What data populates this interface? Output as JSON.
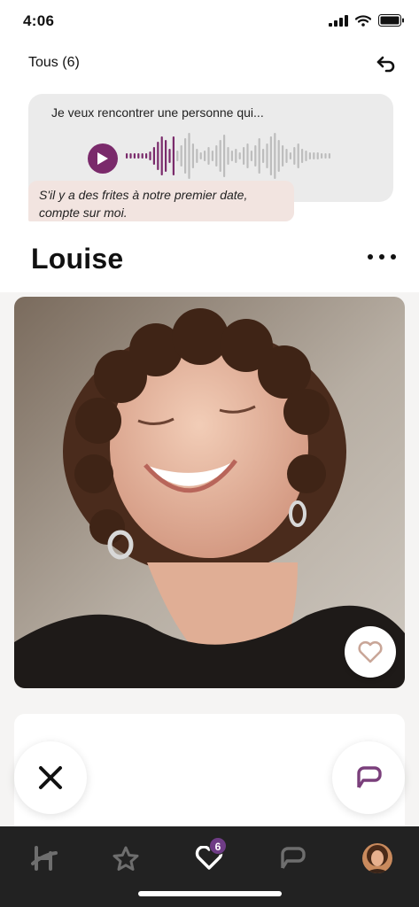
{
  "status_bar": {
    "time": "4:06"
  },
  "header": {
    "filter_label": "Tous (6)"
  },
  "prompt": {
    "title": "Je veux rencontrer une personne qui...",
    "answer": "S'il y a des frites à notre premier date, compte sur moi.",
    "playback_progress": 0.25
  },
  "profile": {
    "name": "Louise"
  },
  "tabs": [
    {
      "name": "hinge-home",
      "icon": "hinge-logo-icon"
    },
    {
      "name": "standouts",
      "icon": "star-icon"
    },
    {
      "name": "likes-you",
      "icon": "heart-icon",
      "badge": "6"
    },
    {
      "name": "matches",
      "icon": "chat-icon"
    },
    {
      "name": "profile",
      "icon": "avatar"
    }
  ],
  "colors": {
    "accent_purple": "#7a2a6b",
    "badge_purple": "#6f3c86",
    "tab_bar": "#222222",
    "prompt_bg": "#ebebeb",
    "answer_bg": "#f2e4e0"
  }
}
